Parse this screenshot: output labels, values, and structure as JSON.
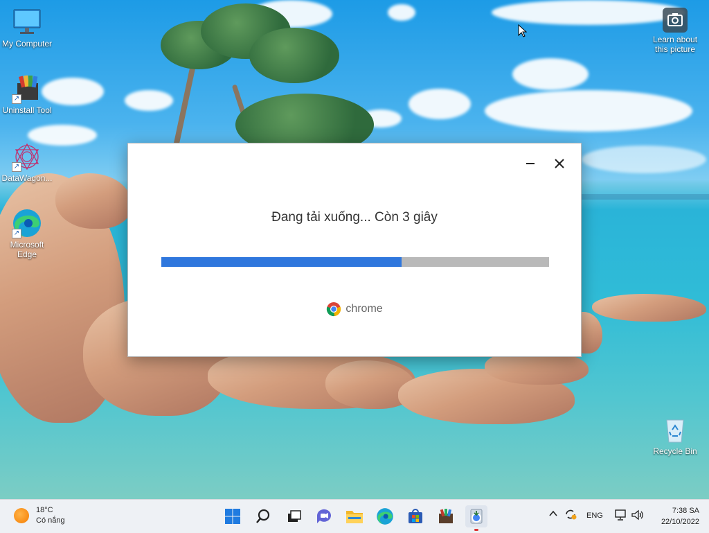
{
  "desktop": {
    "icons_left": [
      {
        "label": "My Computer",
        "icon": "monitor-icon"
      },
      {
        "label": "Uninstall Tool",
        "icon": "uninstall-tool-icon"
      },
      {
        "label": "DataWagon...",
        "icon": "datawagon-icon"
      },
      {
        "label": "Microsoft Edge",
        "icon": "edge-icon"
      }
    ],
    "camera": {
      "label": "Learn about this picture",
      "icon": "camera-icon"
    },
    "recycle_bin": {
      "label": "Recycle Bin",
      "icon": "recycle-bin-icon"
    }
  },
  "dialog": {
    "status_text": "Đang tải xuống... Còn 3 giây",
    "progress_fraction": 0.62,
    "brand_text": "chrome",
    "colors": {
      "progress_fill": "#2f77dd",
      "progress_track": "#b9b9b9"
    }
  },
  "taskbar": {
    "weather": {
      "temp": "18°C",
      "condition": "Có nắng"
    },
    "apps": [
      "start-icon",
      "search-icon",
      "task-view-icon",
      "chat-icon",
      "file-explorer-icon",
      "edge-icon",
      "store-icon",
      "winrar-icon",
      "chrome-installer-icon"
    ],
    "language": "ENG",
    "time": "7:38 SA",
    "date": "22/10/2022"
  }
}
